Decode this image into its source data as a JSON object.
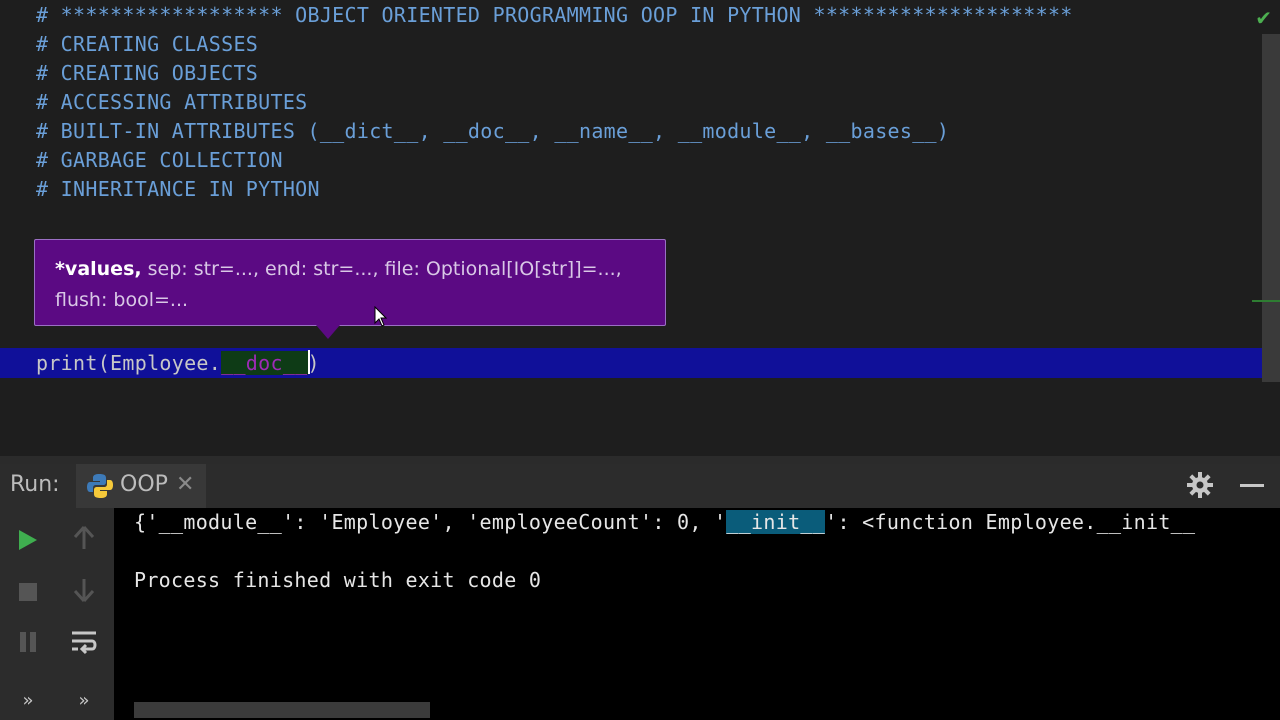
{
  "editor": {
    "lines": [
      "# ****************** OBJECT ORIENTED PROGRAMMING OOP IN PYTHON *********************",
      "# CREATING CLASSES",
      "# CREATING OBJECTS",
      "# ACCESSING ATTRIBUTES",
      "# BUILT-IN ATTRIBUTES (__dict__, __doc__, __name__, __module__, __bases__)",
      "# GARBAGE COLLECTION",
      "# INHERITANCE IN PYTHON"
    ],
    "current_line": {
      "prefix": "print(Employee.",
      "highlight": "__doc__",
      "suffix": ")"
    }
  },
  "tooltip": {
    "bold": "*values,",
    "rest_line1": " sep: str=..., end: str=..., file: Optional[IO[str]]=...,",
    "line2": "flush: bool=..."
  },
  "run_panel": {
    "label": "Run:",
    "tab_name": "OOP",
    "tab_close": "✕"
  },
  "console": {
    "line1_prefix": "{'__module__': 'Employee', 'employeeCount': 0, '",
    "line1_highlight": "__init__",
    "line1_suffix": "': <function Employee.__init__",
    "line2": "Process finished with exit code 0"
  },
  "colors": {
    "comment": "#6a9fd8",
    "tooltip_bg": "#5b0a83",
    "current_line_bg": "#101099",
    "doc_highlight": "#9d2bb5",
    "run_green": "#3fae4f"
  },
  "icons": {
    "run": "play-icon",
    "stop": "stop-icon",
    "pause": "pause-icon",
    "up": "arrow-up-icon",
    "down": "arrow-down-icon",
    "wrap": "soft-wrap-icon",
    "more": "more-icon",
    "settings": "gear-icon",
    "minimize": "minimize-icon",
    "status": "check-icon"
  }
}
